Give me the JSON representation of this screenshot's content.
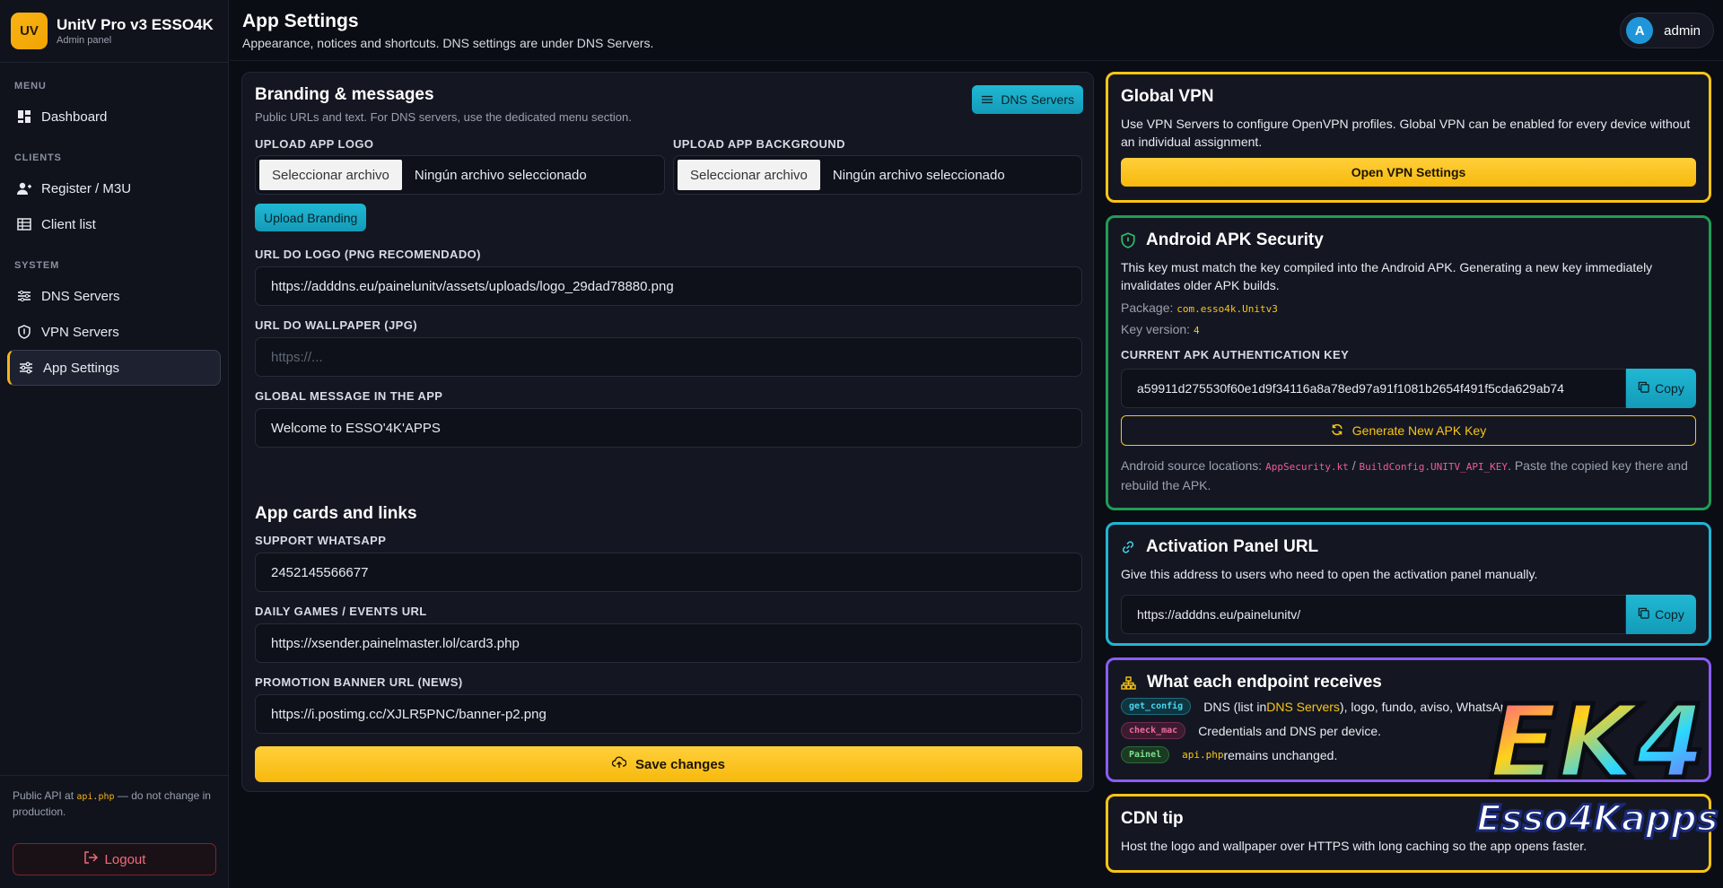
{
  "brand": {
    "logo": "UV",
    "title": "UnitV Pro v3 ESSO4K",
    "subtitle": "Admin panel"
  },
  "nav": {
    "menu_label": "MENU",
    "clients_label": "CLIENTS",
    "system_label": "SYSTEM",
    "items": [
      {
        "label": "Dashboard",
        "icon": "dashboard-icon"
      },
      {
        "label": "Register / M3U",
        "icon": "user-plus-icon"
      },
      {
        "label": "Client list",
        "icon": "table-icon"
      },
      {
        "label": "DNS Servers",
        "icon": "server-icon"
      },
      {
        "label": "VPN Servers",
        "icon": "shield-icon"
      },
      {
        "label": "App Settings",
        "icon": "sliders-icon"
      }
    ]
  },
  "footer": {
    "api_pre": "Public API at ",
    "api_file": "api.php",
    "api_post": " — do not change in production.",
    "logout": "Logout"
  },
  "header": {
    "title": "App Settings",
    "subtitle": "Appearance, notices and shortcuts. DNS settings are under DNS Servers."
  },
  "user": {
    "avatar": "A",
    "name": "admin"
  },
  "branding": {
    "title": "Branding & messages",
    "subtitle": "Public URLs and text. For DNS servers, use the dedicated menu section.",
    "dns_button": "DNS Servers",
    "upload_logo_label": "UPLOAD APP LOGO",
    "upload_bg_label": "UPLOAD APP BACKGROUND",
    "file_button": "Seleccionar archivo",
    "file_none": "Ningún archivo seleccionado",
    "upload_button": "Upload Branding",
    "logo_url_label": "URL DO LOGO (PNG RECOMENDADO)",
    "logo_url_value": "https://adddns.eu/painelunitv/assets/uploads/logo_29dad78880.png",
    "wallpaper_label": "URL DO WALLPAPER (JPG)",
    "wallpaper_placeholder": "https://...",
    "message_label": "GLOBAL MESSAGE IN THE APP",
    "message_value": "Welcome to ESSO'4K'APPS"
  },
  "cards": {
    "title": "App cards and links",
    "whatsapp_label": "SUPPORT WHATSAPP",
    "whatsapp_value": "2452145566677",
    "games_label": "DAILY GAMES / EVENTS URL",
    "games_value": "https://xsender.painelmaster.lol/card3.php",
    "promo_label": "PROMOTION BANNER URL (NEWS)",
    "promo_value": "https://i.postimg.cc/XJLR5PNC/banner-p2.png",
    "save_button": "Save changes"
  },
  "vpn": {
    "title": "Global VPN",
    "text": "Use VPN Servers to configure OpenVPN profiles. Global VPN can be enabled for every device without an individual assignment.",
    "button": "Open VPN Settings"
  },
  "apk": {
    "title": "Android APK Security",
    "text": "This key must match the key compiled into the Android APK. Generating a new key immediately invalidates older APK builds.",
    "package_label": "Package: ",
    "package_value": "com.esso4k.Unitv3",
    "version_label": "Key version: ",
    "version_value": "4",
    "key_label": "CURRENT APK AUTHENTICATION KEY",
    "key_value": "a59911d275530f60e1d9f34116a8a78ed97a91f1081b2654f491f5cda629ab74",
    "copy": "Copy",
    "generate": "Generate New APK Key",
    "source_pre": "Android source locations: ",
    "source_file1": "AppSecurity.kt",
    "source_sep": " / ",
    "source_file2": "BuildConfig.UNITV_API_KEY",
    "source_post": ". Paste the copied key there and rebuild the APK."
  },
  "activation": {
    "title": "Activation Panel URL",
    "text": "Give this address to users who need to open the activation panel manually.",
    "url": "https://adddns.eu/painelunitv/",
    "copy": "Copy"
  },
  "endpoints": {
    "title": "What each endpoint receives",
    "rows": [
      {
        "tag": "get_config",
        "pre": "DNS (list in ",
        "link": "DNS Servers",
        "post": "), logo, fundo, aviso, WhatsAp"
      },
      {
        "tag": "check_mac",
        "text": "Credentials and DNS per device."
      },
      {
        "tag": "Painel",
        "code": "api.php",
        "text": " remains unchanged."
      }
    ]
  },
  "cdn": {
    "title": "CDN tip",
    "text": "Host the logo and wallpaper over HTTPS with long caching so the app opens faster."
  },
  "watermark": {
    "line1": "EK4",
    "line2": "Esso4Kapps"
  },
  "colors": {
    "accent": "#f9b316",
    "teal": "#1fb6d6",
    "green": "#1f9d55",
    "purple": "#8a5cf5"
  }
}
